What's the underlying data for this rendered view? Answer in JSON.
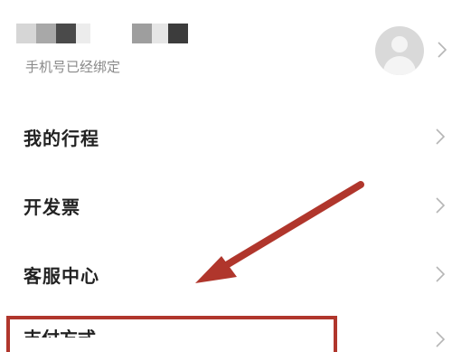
{
  "profile": {
    "subtitle": "手机号已经绑定"
  },
  "menu": [
    {
      "label": "我的行程"
    },
    {
      "label": "开发票"
    },
    {
      "label": "客服中心"
    },
    {
      "label": "支付方式"
    }
  ],
  "colors": {
    "annotation_red": "#b0362c",
    "chevron_gray": "#b5b5b5",
    "subtitle_gray": "#8a8a8a"
  },
  "icons": {
    "avatar": "default-user-icon",
    "row_chevron": "chevron-right-icon"
  }
}
